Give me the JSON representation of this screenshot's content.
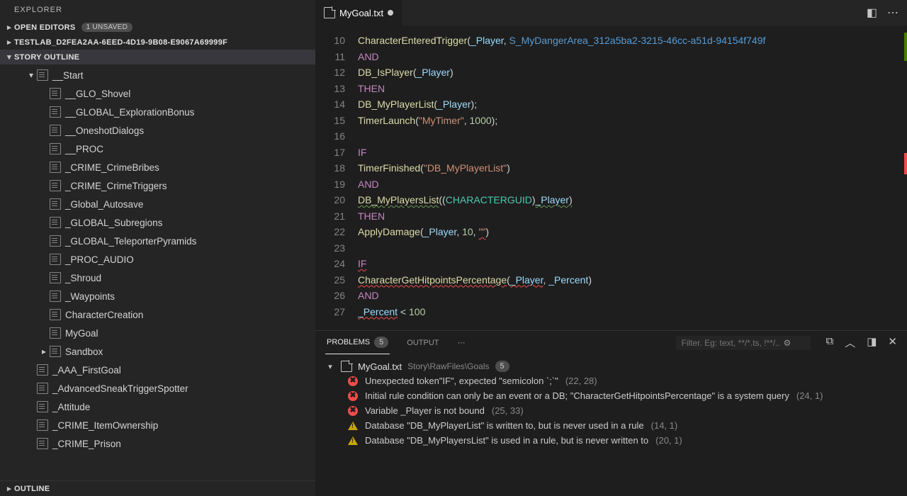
{
  "sidebar": {
    "title": "EXPLORER",
    "open_editors": {
      "label": "OPEN EDITORS",
      "badge": "1 UNSAVED"
    },
    "project": {
      "label": "TESTLAB_D2FEA2AA-6EED-4D19-9B08-E9067A69999F"
    },
    "story_outline": {
      "label": "STORY OUTLINE"
    },
    "outline": {
      "label": "OUTLINE"
    },
    "tree": [
      {
        "depth": 1,
        "caret": "▾",
        "label": "__Start"
      },
      {
        "depth": 2,
        "caret": "",
        "label": "__GLO_Shovel"
      },
      {
        "depth": 2,
        "caret": "",
        "label": "__GLOBAL_ExplorationBonus"
      },
      {
        "depth": 2,
        "caret": "",
        "label": "__OneshotDialogs"
      },
      {
        "depth": 2,
        "caret": "",
        "label": "__PROC"
      },
      {
        "depth": 2,
        "caret": "",
        "label": "_CRIME_CrimeBribes"
      },
      {
        "depth": 2,
        "caret": "",
        "label": "_CRIME_CrimeTriggers"
      },
      {
        "depth": 2,
        "caret": "",
        "label": "_Global_Autosave"
      },
      {
        "depth": 2,
        "caret": "",
        "label": "_GLOBAL_Subregions"
      },
      {
        "depth": 2,
        "caret": "",
        "label": "_GLOBAL_TeleporterPyramids"
      },
      {
        "depth": 2,
        "caret": "",
        "label": "_PROC_AUDIO"
      },
      {
        "depth": 2,
        "caret": "",
        "label": "_Shroud"
      },
      {
        "depth": 2,
        "caret": "",
        "label": "_Waypoints"
      },
      {
        "depth": 2,
        "caret": "",
        "label": "CharacterCreation"
      },
      {
        "depth": 2,
        "caret": "",
        "label": "MyGoal"
      },
      {
        "depth": 2,
        "caret": "▸",
        "label": "Sandbox"
      },
      {
        "depth": 1,
        "caret": "",
        "label": "_AAA_FirstGoal"
      },
      {
        "depth": 1,
        "caret": "",
        "label": "_AdvancedSneakTriggerSpotter"
      },
      {
        "depth": 1,
        "caret": "",
        "label": "_Attitude"
      },
      {
        "depth": 1,
        "caret": "",
        "label": "_CRIME_ItemOwnership"
      },
      {
        "depth": 1,
        "caret": "",
        "label": "_CRIME_Prison"
      }
    ]
  },
  "tab": {
    "filename": "MyGoal.txt"
  },
  "editor": {
    "first_line": 10,
    "lines": [
      {
        "n": 10,
        "tokens": [
          [
            "fn",
            "CharacterEnteredTrigger"
          ],
          [
            "pl",
            "("
          ],
          [
            "lit",
            "_Player"
          ],
          [
            "pl",
            ", "
          ],
          [
            "blue",
            "S_MyDangerArea_312a5ba2-3215-46cc-a51d-94154f749f"
          ]
        ]
      },
      {
        "n": 11,
        "tokens": [
          [
            "pink",
            "AND"
          ]
        ]
      },
      {
        "n": 12,
        "tokens": [
          [
            "fn",
            "DB_IsPlayer"
          ],
          [
            "pl",
            "("
          ],
          [
            "lit",
            "_Player"
          ],
          [
            "pl",
            ")"
          ]
        ]
      },
      {
        "n": 13,
        "tokens": [
          [
            "pink",
            "THEN"
          ]
        ]
      },
      {
        "n": 14,
        "tokens": [
          [
            "fn",
            "DB_MyPlayerList"
          ],
          [
            "pl",
            "("
          ],
          [
            "lit",
            "_Player"
          ],
          [
            "pl",
            ");"
          ]
        ]
      },
      {
        "n": 15,
        "tokens": [
          [
            "fn",
            "TimerLaunch"
          ],
          [
            "pl",
            "("
          ],
          [
            "str",
            "\"MyTimer\""
          ],
          [
            "pl",
            ", "
          ],
          [
            "num",
            "1000"
          ],
          [
            "pl",
            ");"
          ]
        ]
      },
      {
        "n": 16,
        "tokens": []
      },
      {
        "n": 17,
        "tokens": [
          [
            "pink",
            "IF"
          ]
        ]
      },
      {
        "n": 18,
        "tokens": [
          [
            "fn",
            "TimerFinished"
          ],
          [
            "pl",
            "("
          ],
          [
            "str",
            "\"DB_MyPlayerList\""
          ],
          [
            "pl",
            ")"
          ]
        ]
      },
      {
        "n": 19,
        "tokens": [
          [
            "pink",
            "AND"
          ]
        ]
      },
      {
        "n": 20,
        "tokens": [
          [
            "fn-sqg",
            "DB_MyPlayersList"
          ],
          [
            "pl",
            "(("
          ],
          [
            "teal",
            "CHARACTERGUID"
          ],
          [
            "pl",
            ")"
          ],
          [
            "lit-sqg",
            "_Player"
          ],
          [
            "pl-sqg",
            ")"
          ]
        ]
      },
      {
        "n": 21,
        "tokens": [
          [
            "pink",
            "THEN"
          ]
        ]
      },
      {
        "n": 22,
        "tokens": [
          [
            "fn",
            "ApplyDamage"
          ],
          [
            "pl",
            "("
          ],
          [
            "lit",
            "_Player"
          ],
          [
            "pl",
            ", "
          ],
          [
            "num",
            "10"
          ],
          [
            "pl",
            ", "
          ],
          [
            "str-sqr",
            "\"\""
          ],
          [
            "pl",
            ")"
          ]
        ]
      },
      {
        "n": 23,
        "tokens": []
      },
      {
        "n": 24,
        "tokens": [
          [
            "pink-sqr",
            "IF"
          ]
        ]
      },
      {
        "n": 25,
        "tokens": [
          [
            "fn-sqr",
            "CharacterGetHitpointsPercentage"
          ],
          [
            "pl",
            "("
          ],
          [
            "lit-sqr",
            "_Player"
          ],
          [
            "pl",
            ", "
          ],
          [
            "lit",
            "_Percent"
          ],
          [
            "pl",
            ")"
          ]
        ]
      },
      {
        "n": 26,
        "tokens": [
          [
            "pink",
            "AND"
          ]
        ]
      },
      {
        "n": 27,
        "tokens": [
          [
            "lit-sqr",
            "_Percent"
          ],
          [
            "pl",
            " < "
          ],
          [
            "num",
            "100"
          ]
        ]
      }
    ]
  },
  "panel": {
    "tabs": {
      "problems": "PROBLEMS",
      "problems_count": "5",
      "output": "OUTPUT"
    },
    "filter_placeholder": "Filter. Eg: text, **/*.ts, !**/...",
    "file": {
      "name": "MyGoal.txt",
      "path": "Story\\RawFiles\\Goals",
      "count": "5"
    },
    "items": [
      {
        "sev": "err",
        "msg": "Unexpected token\"IF\", expected \"semicolon `;`\"",
        "loc": "(22, 28)"
      },
      {
        "sev": "err",
        "msg": "Initial rule condition can only be an event or a DB; \"CharacterGetHitpointsPercentage\" is a system query",
        "loc": "(24, 1)"
      },
      {
        "sev": "err",
        "msg": "Variable _Player is not bound",
        "loc": "(25, 33)"
      },
      {
        "sev": "warn",
        "msg": "Database \"DB_MyPlayerList\" is written to, but is never used in a rule",
        "loc": "(14, 1)"
      },
      {
        "sev": "warn",
        "msg": "Database \"DB_MyPlayersList\" is used in a rule, but is never written to",
        "loc": "(20, 1)"
      }
    ]
  }
}
